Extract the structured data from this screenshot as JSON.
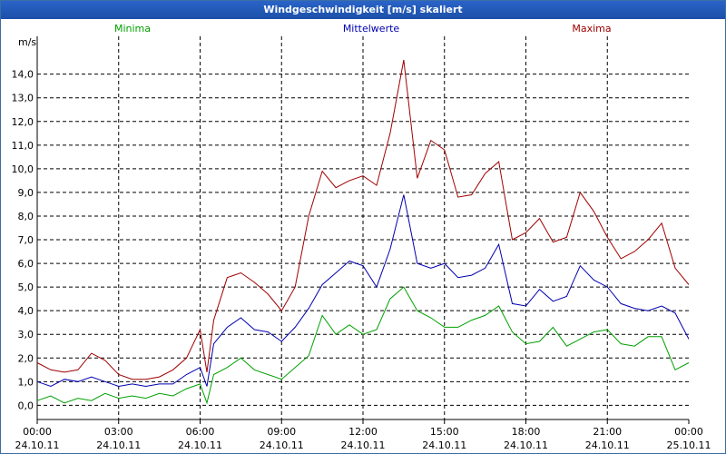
{
  "window": {
    "title": "Windgeschwindigkeit [m/s] skaliert"
  },
  "chart_data": {
    "type": "line",
    "title": "Windgeschwindigkeit [m/s] skaliert",
    "ylabel": "m/s",
    "xlabel": "",
    "ylim": [
      -0.6,
      15.6
    ],
    "xlim_hours": [
      0,
      24
    ],
    "grid": true,
    "legend_position": "top",
    "yticks": [
      "0,0",
      "1,0",
      "2,0",
      "3,0",
      "4,0",
      "5,0",
      "6,0",
      "7,0",
      "8,0",
      "9,0",
      "10,0",
      "11,0",
      "12,0",
      "13,0",
      "14,0"
    ],
    "xticks": [
      {
        "time": "00:00",
        "date": "24.10.11"
      },
      {
        "time": "03:00",
        "date": "24.10.11"
      },
      {
        "time": "06:00",
        "date": "24.10.11"
      },
      {
        "time": "09:00",
        "date": "24.10.11"
      },
      {
        "time": "12:00",
        "date": "24.10.11"
      },
      {
        "time": "15:00",
        "date": "24.10.11"
      },
      {
        "time": "18:00",
        "date": "24.10.11"
      },
      {
        "time": "21:00",
        "date": "24.10.11"
      },
      {
        "time": "00:00",
        "date": "25.10.11"
      }
    ],
    "series": [
      {
        "name": "Minima",
        "color": "#00a000",
        "x": [
          0,
          0.5,
          1,
          1.5,
          2,
          2.5,
          3,
          3.5,
          4,
          4.5,
          5,
          5.5,
          6,
          6.25,
          6.5,
          7,
          7.5,
          8,
          8.5,
          9,
          9.5,
          10,
          10.5,
          11,
          11.5,
          12,
          12.5,
          13,
          13.5,
          14,
          14.5,
          15,
          15.5,
          16,
          16.5,
          17,
          17.5,
          18,
          18.5,
          19,
          19.5,
          20,
          20.5,
          21,
          21.5,
          22,
          22.5,
          23,
          23.5,
          24
        ],
        "values": [
          0.2,
          0.4,
          0.1,
          0.3,
          0.2,
          0.5,
          0.3,
          0.4,
          0.3,
          0.5,
          0.4,
          0.7,
          0.9,
          0.1,
          1.3,
          1.6,
          2.0,
          1.5,
          1.3,
          1.1,
          1.6,
          2.1,
          3.8,
          3.0,
          3.4,
          3.0,
          3.2,
          4.5,
          5.0,
          4.0,
          3.7,
          3.3,
          3.3,
          3.6,
          3.8,
          4.2,
          3.1,
          2.6,
          2.7,
          3.3,
          2.5,
          2.8,
          3.1,
          3.2,
          2.6,
          2.5,
          2.9,
          2.9,
          1.5,
          1.8
        ]
      },
      {
        "name": "Mittelwerte",
        "color": "#0000b0",
        "x": [
          0,
          0.5,
          1,
          1.5,
          2,
          2.5,
          3,
          3.5,
          4,
          4.5,
          5,
          5.5,
          6,
          6.25,
          6.5,
          7,
          7.5,
          8,
          8.5,
          9,
          9.5,
          10,
          10.5,
          11,
          11.5,
          12,
          12.5,
          13,
          13.5,
          14,
          14.5,
          15,
          15.5,
          16,
          16.5,
          17,
          17.5,
          18,
          18.5,
          19,
          19.5,
          20,
          20.5,
          21,
          21.5,
          22,
          22.5,
          23,
          23.5,
          24
        ],
        "values": [
          1.0,
          0.8,
          1.1,
          1.0,
          1.2,
          1.0,
          0.8,
          0.9,
          0.8,
          0.9,
          0.9,
          1.3,
          1.6,
          0.8,
          2.6,
          3.3,
          3.7,
          3.2,
          3.1,
          2.7,
          3.3,
          4.1,
          5.1,
          5.6,
          6.1,
          5.9,
          5.0,
          6.6,
          8.9,
          6.0,
          5.8,
          6.0,
          5.4,
          5.5,
          5.8,
          6.8,
          4.3,
          4.2,
          4.9,
          4.4,
          4.6,
          5.9,
          5.3,
          5.0,
          4.3,
          4.1,
          4.0,
          4.2,
          3.9,
          2.8
        ]
      },
      {
        "name": "Maxima",
        "color": "#a00000",
        "x": [
          0,
          0.5,
          1,
          1.5,
          2,
          2.5,
          3,
          3.5,
          4,
          4.5,
          5,
          5.5,
          6,
          6.25,
          6.5,
          7,
          7.5,
          8,
          8.5,
          9,
          9.5,
          10,
          10.5,
          11,
          11.5,
          12,
          12.5,
          13,
          13.5,
          14,
          14.5,
          15,
          15.5,
          16,
          16.5,
          17,
          17.5,
          18,
          18.5,
          19,
          19.5,
          20,
          20.5,
          21,
          21.5,
          22,
          22.5,
          23,
          23.5,
          24
        ],
        "values": [
          1.8,
          1.5,
          1.4,
          1.5,
          2.2,
          1.9,
          1.3,
          1.1,
          1.1,
          1.2,
          1.5,
          2.0,
          3.2,
          1.4,
          3.6,
          5.4,
          5.6,
          5.2,
          4.7,
          4.0,
          5.0,
          8.0,
          9.9,
          9.2,
          9.5,
          9.7,
          9.3,
          11.5,
          14.6,
          9.6,
          11.2,
          10.8,
          8.8,
          8.9,
          9.8,
          10.3,
          7.0,
          7.3,
          7.9,
          6.9,
          7.1,
          9.0,
          8.2,
          7.1,
          6.2,
          6.5,
          7.0,
          7.7,
          5.8,
          5.1
        ]
      }
    ]
  }
}
